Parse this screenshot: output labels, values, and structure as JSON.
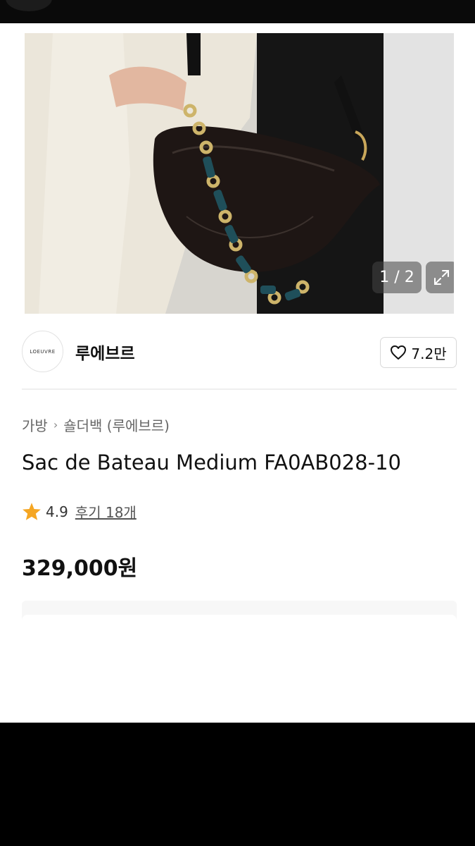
{
  "gallery": {
    "counter": "1 / 2",
    "expand_icon": "expand-icon"
  },
  "brand": {
    "logo_text": "LOEUVRE",
    "name": "루에브르"
  },
  "like": {
    "icon": "heart-icon",
    "count": "7.2만"
  },
  "breadcrumb": {
    "category": "가방",
    "separator": "›",
    "subcategory": "숄더백 (루에브르)"
  },
  "product": {
    "title": "Sac de Bateau Medium FA0AB028-10",
    "rating": "4.9",
    "reviews": "후기 18개",
    "price": "329,000원"
  },
  "colors": {
    "star": "#F5A623",
    "text": "#111111"
  }
}
